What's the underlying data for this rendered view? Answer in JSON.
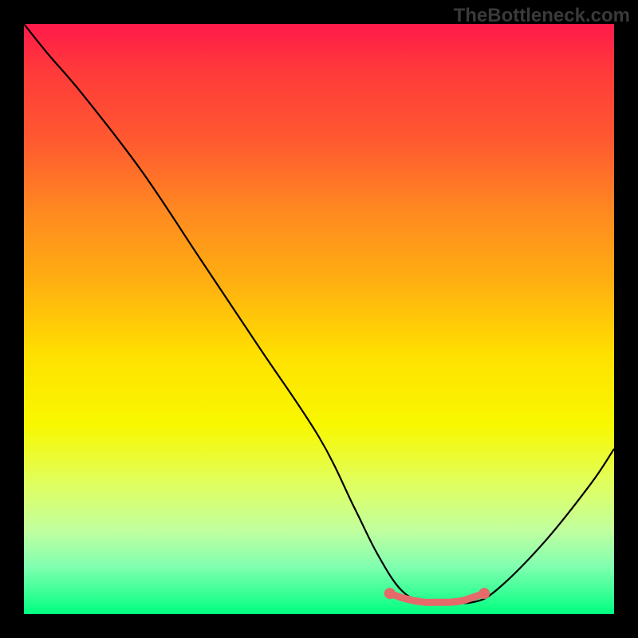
{
  "watermark": "TheBottleneck.com",
  "chart_data": {
    "type": "line",
    "title": "",
    "xlabel": "",
    "ylabel": "",
    "xlim": [
      0,
      100
    ],
    "ylim": [
      0,
      100
    ],
    "series": [
      {
        "name": "bottleneck-curve",
        "x": [
          0,
          4,
          10,
          20,
          30,
          40,
          50,
          56,
          60,
          64,
          68,
          72,
          76,
          80,
          88,
          96,
          100
        ],
        "values": [
          100,
          95,
          88,
          75,
          60,
          45,
          30,
          18,
          10,
          4,
          2,
          2,
          2,
          4,
          12,
          22,
          28
        ]
      },
      {
        "name": "highlight-flat-region",
        "x": [
          62,
          64,
          66,
          68,
          70,
          72,
          74,
          76,
          78
        ],
        "values": [
          3.5,
          2.8,
          2.3,
          2.0,
          2.0,
          2.0,
          2.2,
          2.8,
          3.5
        ]
      }
    ],
    "gradient_stops": [
      {
        "pos": 0,
        "color": "#ff1a4a"
      },
      {
        "pos": 20,
        "color": "#ff5a30"
      },
      {
        "pos": 44,
        "color": "#ffb010"
      },
      {
        "pos": 68,
        "color": "#f8f800"
      },
      {
        "pos": 100,
        "color": "#00ff80"
      }
    ],
    "highlight_color": "#e56a6a",
    "curve_color": "#000000"
  }
}
